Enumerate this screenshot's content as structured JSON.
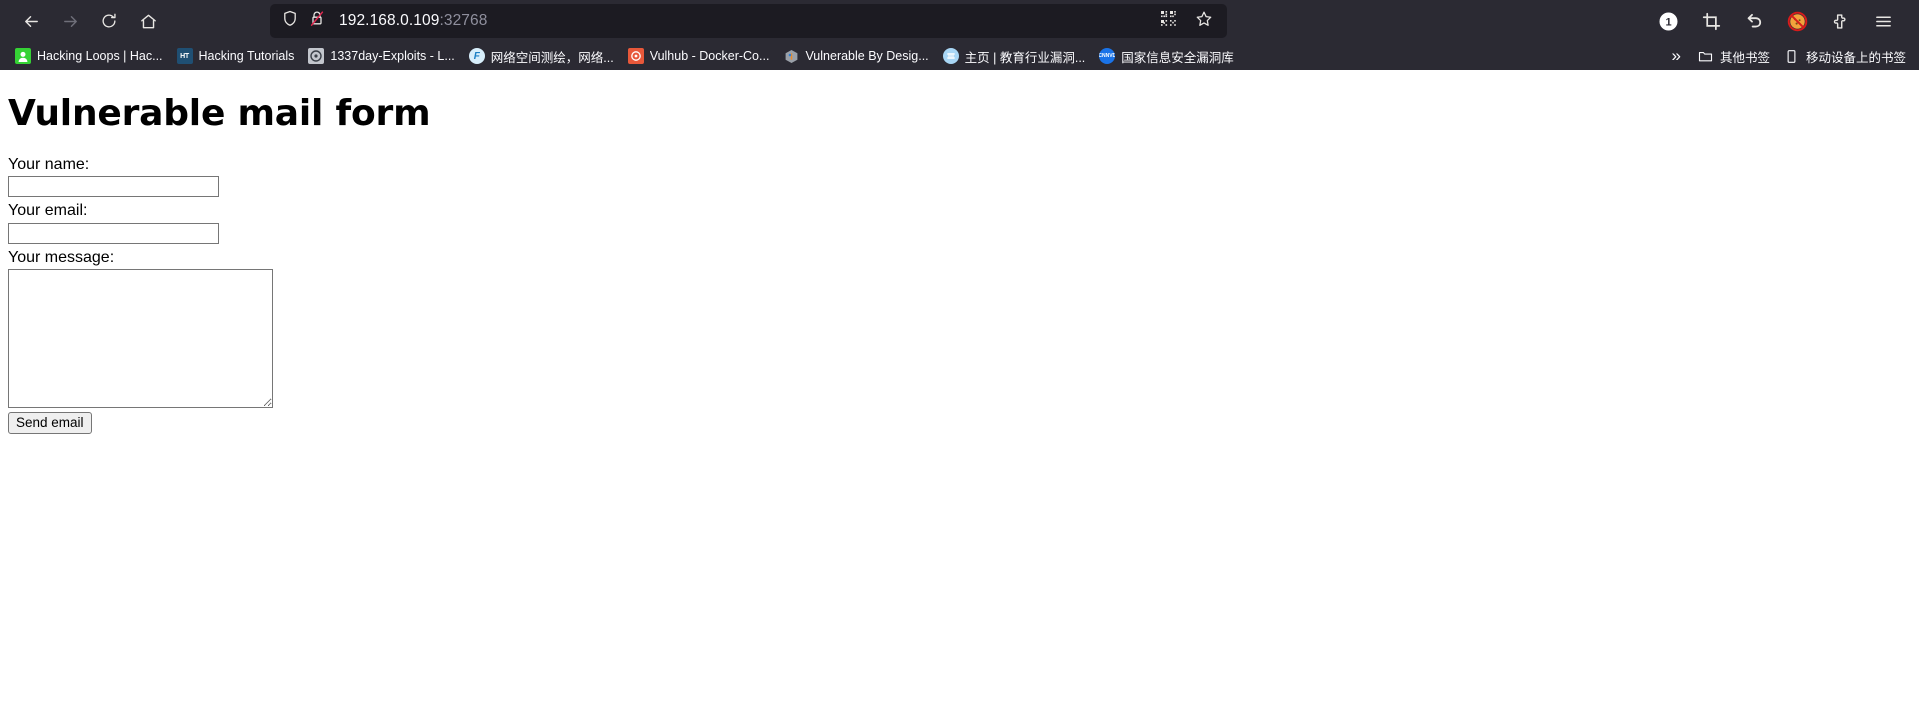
{
  "browser": {
    "nav": {
      "back_label": "Back",
      "forward_label": "Forward",
      "reload_label": "Reload",
      "home_label": "Home"
    },
    "urlbar": {
      "host": "192.168.0.109",
      "port": ":32768",
      "shield_label": "Enhanced Tracking Protection",
      "lock_label": "Connection is not secure",
      "qr_label": "QR code",
      "bookmark_label": "Bookmark this page"
    },
    "toolbar_right": [
      {
        "name": "account-badge",
        "label": "1"
      },
      {
        "name": "screenshot-crop",
        "label": "Take a screenshot"
      },
      {
        "name": "undo-arrow",
        "label": "Undo"
      },
      {
        "name": "no-cookie",
        "label": "Cookie blocker"
      },
      {
        "name": "extensions-puzzle",
        "label": "Extensions"
      },
      {
        "name": "hamburger-menu",
        "label": "Open application menu"
      }
    ],
    "bookmarks": [
      {
        "label": "Hacking Loops | Hac...",
        "icon": "hacking-loops",
        "color": "#35d235",
        "glyph": ""
      },
      {
        "label": "Hacking Tutorials",
        "icon": "hacking-tutorials",
        "color": "#1f4f73",
        "glyph": "HT"
      },
      {
        "label": "1337day-Exploits - L...",
        "icon": "1337day",
        "color": "#b9bcc4",
        "glyph": ""
      },
      {
        "label": "网络空间测绘，网络...",
        "icon": "fofa",
        "color": "#cfe8f7",
        "glyph": "F"
      },
      {
        "label": "Vulhub - Docker-Co...",
        "icon": "vulhub",
        "color": "#e8583a",
        "glyph": ""
      },
      {
        "label": "Vulnerable By Desig...",
        "icon": "vulnhub",
        "color": "#9aa0a8",
        "glyph": ""
      },
      {
        "label": "主页 | 教育行业漏洞...",
        "icon": "edu-vuln",
        "color": "#a8d6f5",
        "glyph": ""
      },
      {
        "label": "国家信息安全漏洞库",
        "icon": "cnnvd",
        "color": "#1a73e8",
        "glyph": "CNNVD"
      }
    ],
    "bookmarks_overflow_label": "»",
    "bookmark_folders": [
      {
        "label": "其他书签",
        "icon": "folder-icon"
      },
      {
        "label": "移动设备上的书签",
        "icon": "mobile-icon"
      }
    ]
  },
  "page": {
    "title": "Vulnerable mail form",
    "form": {
      "name_label": "Your name:",
      "name_value": "",
      "name_placeholder": "",
      "email_label": "Your email:",
      "email_value": "",
      "email_placeholder": "",
      "message_label": "Your message:",
      "message_value": "",
      "message_placeholder": "",
      "submit_label": "Send email"
    }
  }
}
